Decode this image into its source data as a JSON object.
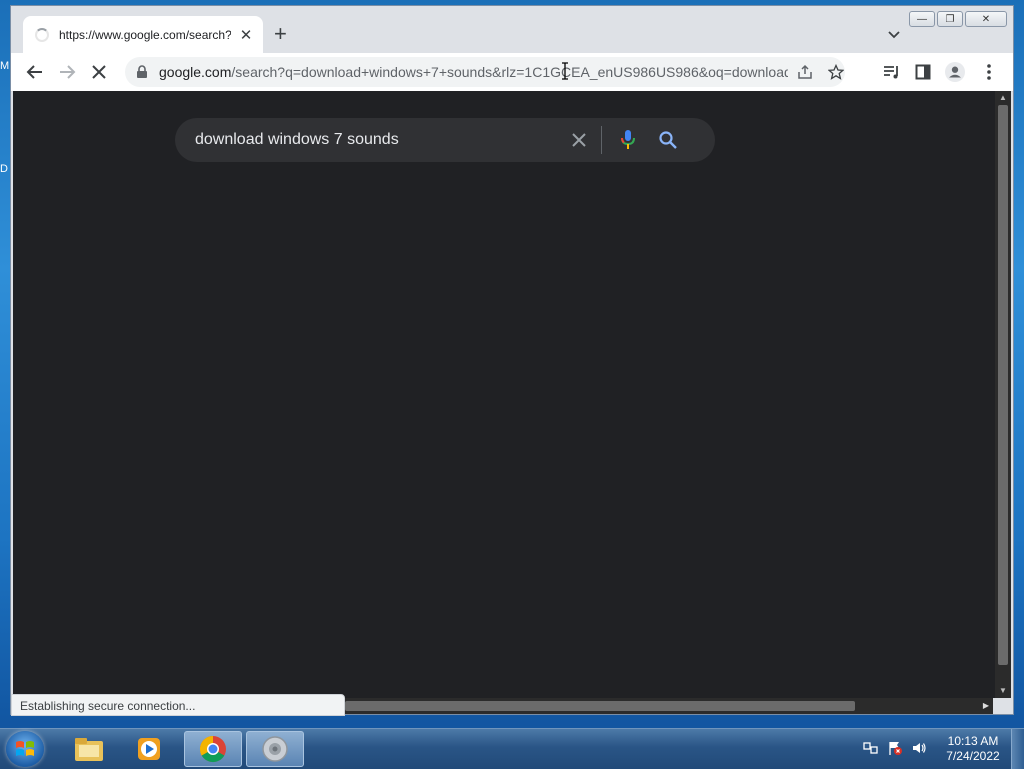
{
  "desktop": {
    "edge_letters": [
      "M",
      "D"
    ]
  },
  "browser": {
    "tab": {
      "title": "https://www.google.com/search?",
      "close_label": "✕"
    },
    "new_tab_label": "+",
    "window_buttons": {
      "minimize": "—",
      "restore": "❐",
      "close": "✕"
    },
    "url": {
      "host": "google.com",
      "path": "/search?q=download+windows+7+sounds&rlz=1C1GCEA_enUS986US986&oq=download..."
    },
    "icons": [
      "back-icon",
      "forward-icon",
      "stop-icon",
      "lock-icon",
      "share-icon",
      "star-icon",
      "media-icon",
      "side-panel-icon",
      "profile-icon",
      "menu-icon"
    ],
    "status_text": "Establishing secure connection..."
  },
  "search": {
    "query": "download windows 7 sounds",
    "colors": {
      "background": "#202124",
      "box": "#303134",
      "text": "#e8eaed"
    }
  },
  "taskbar": {
    "apps": [
      "start-orb",
      "explorer-icon",
      "media-player-icon",
      "chrome-icon",
      "speaker-app-icon"
    ],
    "clock": {
      "time": "10:13 AM",
      "date": "7/24/2022"
    }
  }
}
